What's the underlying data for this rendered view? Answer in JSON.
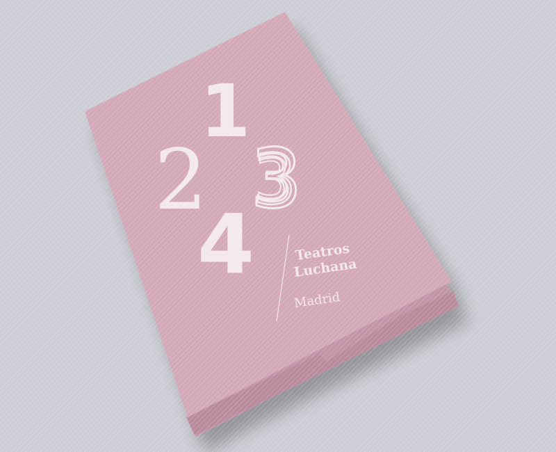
{
  "scene": {
    "description_alt": "",
    "background_color": "#cdcdd5",
    "cover_color": "#d3a8b7",
    "cover_shade_color": "#c295a6",
    "edge_color": "#b98b9c",
    "text_color": "#f3e8ec"
  },
  "brochure": {
    "numerals": {
      "one": "1",
      "two": "2",
      "three": "3",
      "four": "4"
    },
    "brand_line1": "Teatros",
    "brand_line2": "Luchana",
    "brand_city": "Madrid"
  }
}
